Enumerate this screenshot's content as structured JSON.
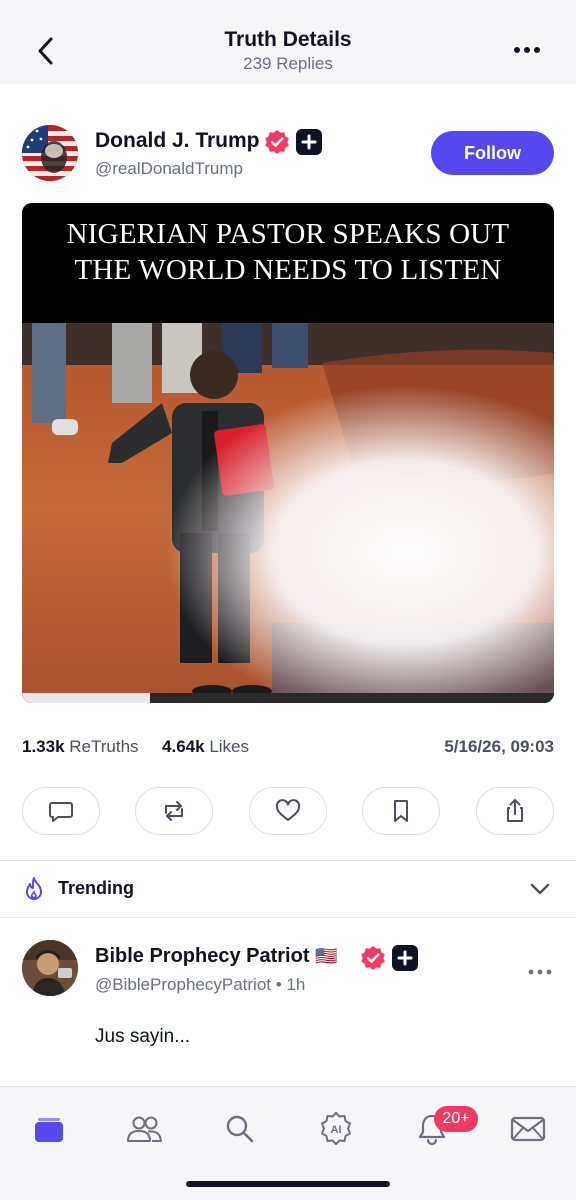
{
  "header": {
    "title": "Truth Details",
    "subtitle": "239 Replies",
    "back_icon": "chevron-left-icon",
    "more_icon": "more-horizontal-icon"
  },
  "post": {
    "author": {
      "name": "Donald J. Trump",
      "handle": "@realDonaldTrump",
      "avatar": "flag-portrait-avatar"
    },
    "follow_label": "Follow",
    "media": {
      "caption_line1": "NIGERIAN PASTOR SPEAKS OUT",
      "caption_line2": "THE WORLD NEEDS TO LISTEN",
      "video_progress": 0.24
    },
    "stats": {
      "retruths_count": "1.33k",
      "retruths_label": "ReTruths",
      "likes_count": "4.64k",
      "likes_label": "Likes",
      "timestamp": "5/16/26, 09:03"
    },
    "actions": [
      "reply-icon",
      "retruth-icon",
      "like-icon",
      "bookmark-icon",
      "share-icon"
    ]
  },
  "trending": {
    "label": "Trending",
    "icon": "flame-icon",
    "chevron": "chevron-down-icon"
  },
  "reply": {
    "name": "Bible Prophecy Patriot",
    "flag": "🇺🇸",
    "handle_time": "@BibleProphecyPatriot • 1h",
    "text": "Jus sayin..."
  },
  "tabbar": {
    "tabs": [
      "home-icon",
      "people-icon",
      "search-icon",
      "ai-icon",
      "bell-icon",
      "mail-icon"
    ],
    "notifications_badge": "20+"
  },
  "colors": {
    "accent": "#5448ee",
    "verified": "#ef3b63",
    "badge": "#ef3b63",
    "text_primary": "#111322",
    "text_secondary": "#6b6f80"
  }
}
